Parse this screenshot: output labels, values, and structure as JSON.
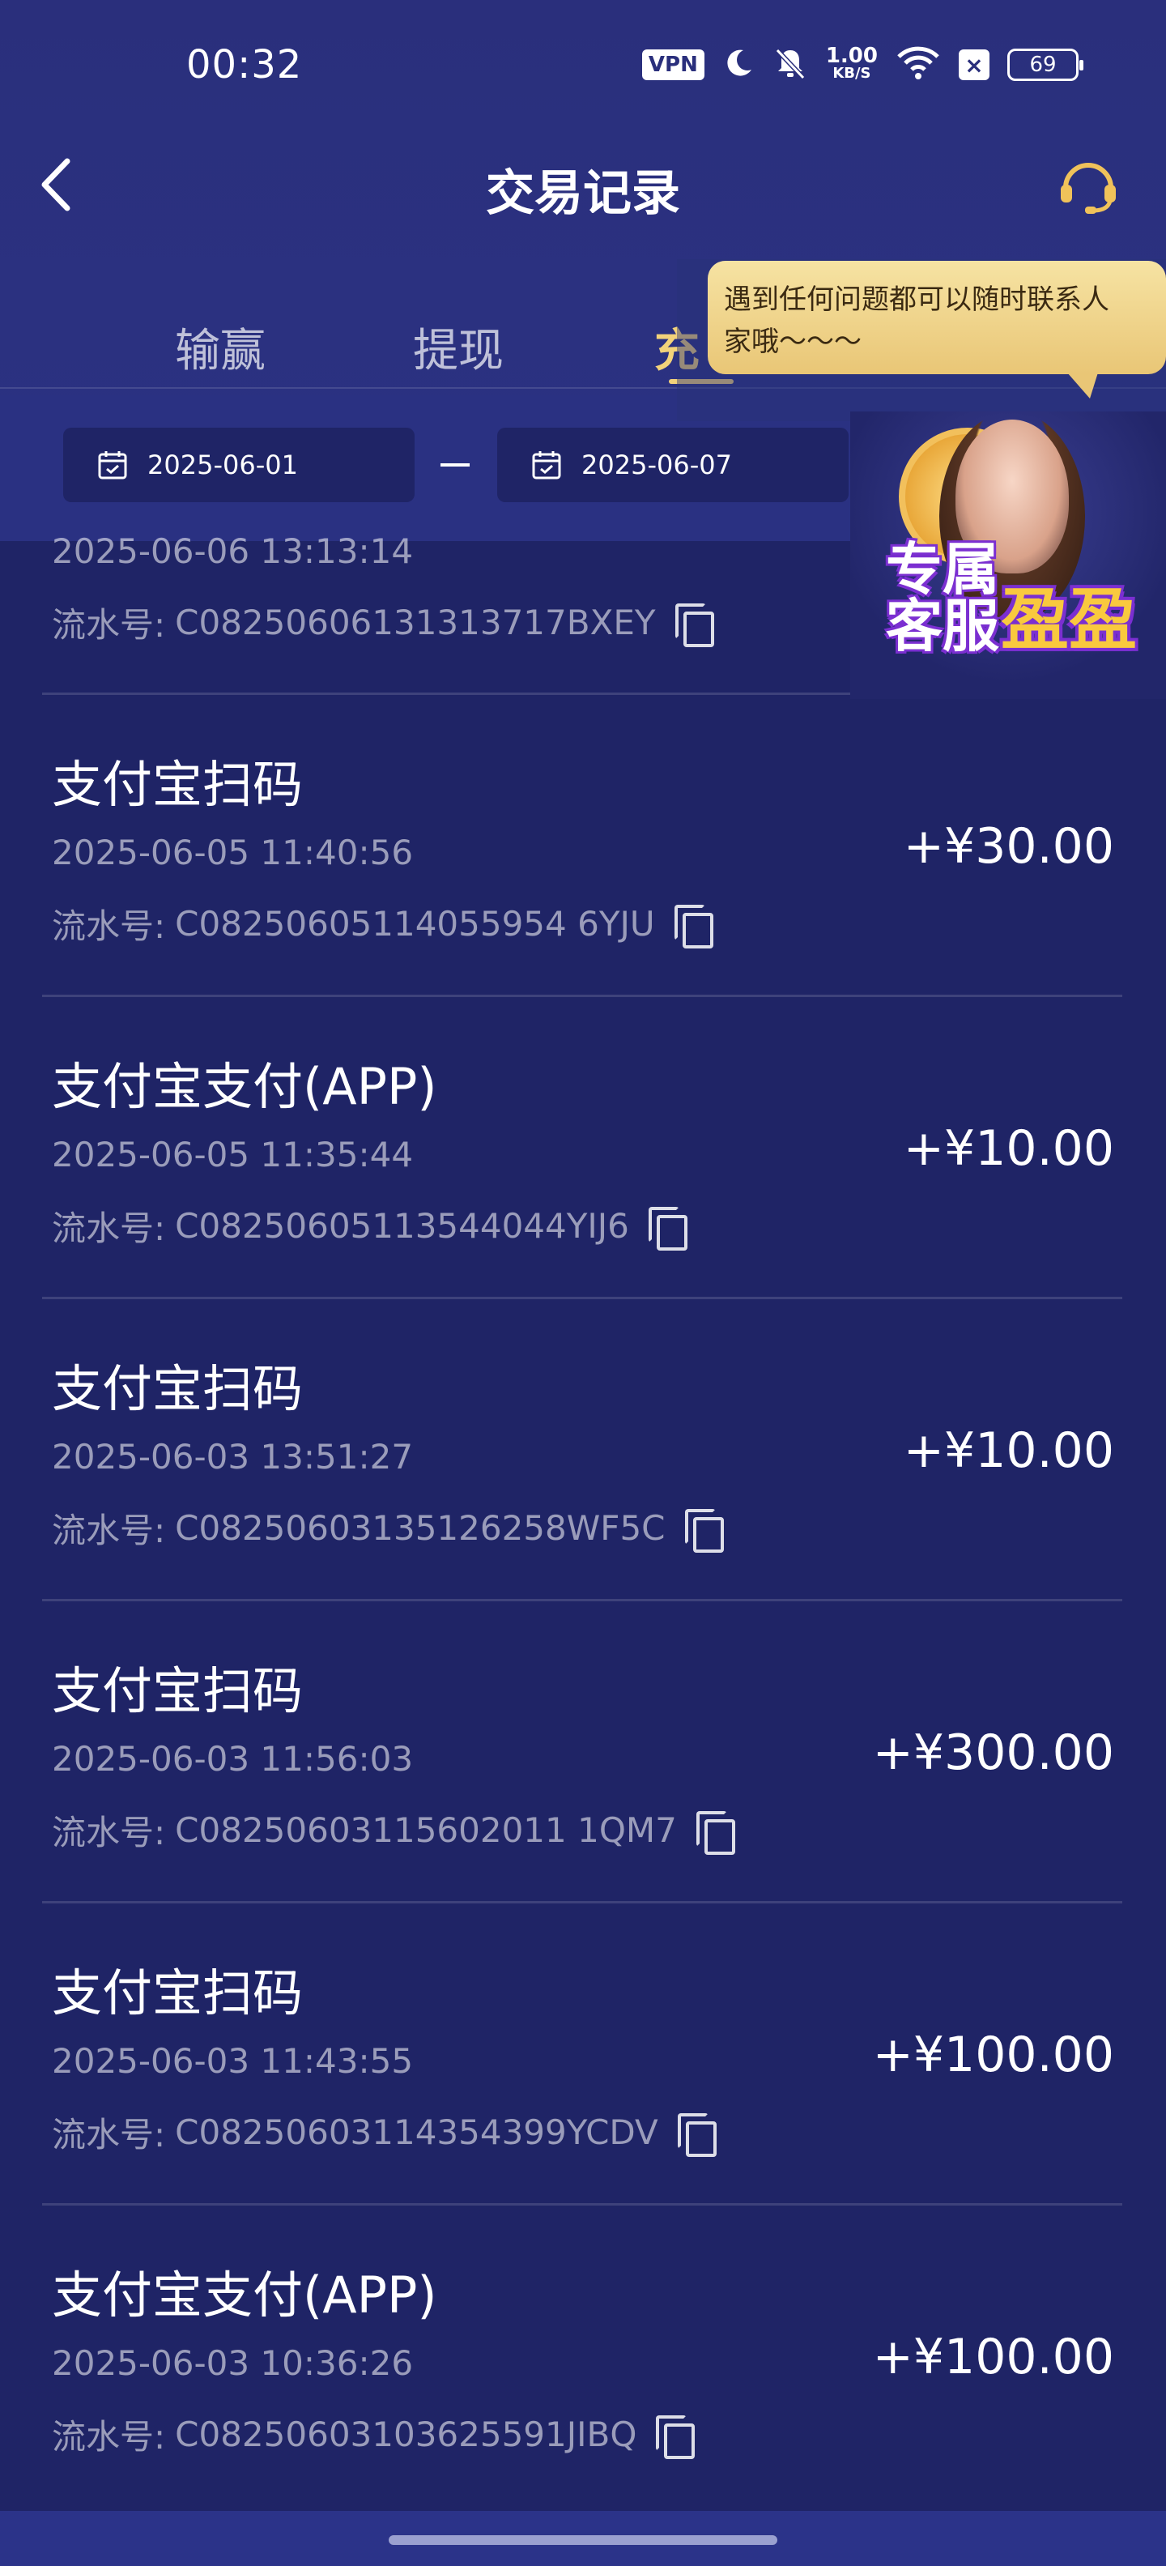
{
  "status_bar": {
    "time": "00:32",
    "vpn": "VPN",
    "net_speed_value": "1.00",
    "net_speed_unit": "KB/S",
    "battery": "69",
    "icons": [
      "vpn-icon",
      "moon-icon",
      "mute-bell-icon",
      "wifi-icon",
      "close-box-icon",
      "battery-icon"
    ]
  },
  "header": {
    "title": "交易记录",
    "back_icon": "chevron-left-icon",
    "support_icon": "headset-icon"
  },
  "tabs": [
    {
      "label": "输赢",
      "active": false
    },
    {
      "label": "提现",
      "active": false
    },
    {
      "label": "充",
      "active": true
    }
  ],
  "tooltip": {
    "text_line1": "遇到任何问题都可以随时联系人",
    "text_line2": "家哦～～～"
  },
  "filter": {
    "start_date": "2025-06-01",
    "end_date": "2025-06-07",
    "separator": "—",
    "calendar_icon": "calendar-icon"
  },
  "promo": {
    "line1": "专属客服",
    "line2": "盈盈"
  },
  "partial_item": {
    "time": "2025-06-06 13:13:14",
    "serial_label": "流水号:",
    "serial": "C08250606131313717BXEY"
  },
  "items": [
    {
      "title": "支付宝扫码",
      "time": "2025-06-05 11:40:56",
      "serial_label": "流水号:",
      "serial": "C08250605114055954 6YJU",
      "amount": "+¥30.00"
    },
    {
      "title": "支付宝支付(APP)",
      "time": "2025-06-05 11:35:44",
      "serial_label": "流水号:",
      "serial": "C08250605113544044YIJ6",
      "amount": "+¥10.00"
    },
    {
      "title": "支付宝扫码",
      "time": "2025-06-03 13:51:27",
      "serial_label": "流水号:",
      "serial": "C08250603135126258WF5C",
      "amount": "+¥10.00"
    },
    {
      "title": "支付宝扫码",
      "time": "2025-06-03 11:56:03",
      "serial_label": "流水号:",
      "serial": "C08250603115602011 1QM7",
      "amount": "+¥300.00"
    },
    {
      "title": "支付宝扫码",
      "time": "2025-06-03 11:43:55",
      "serial_label": "流水号:",
      "serial": "C08250603114354399YCDV",
      "amount": "+¥100.00"
    },
    {
      "title": "支付宝支付(APP)",
      "time": "2025-06-03 10:36:26",
      "serial_label": "流水号:",
      "serial": "C08250603103625591JIBQ",
      "amount": "+¥100.00"
    }
  ],
  "colors": {
    "background": "#1f2466",
    "header_bg": "#2a2f7c",
    "accent_gold": "#f2d27a",
    "muted_text": "#9a9cc4"
  }
}
